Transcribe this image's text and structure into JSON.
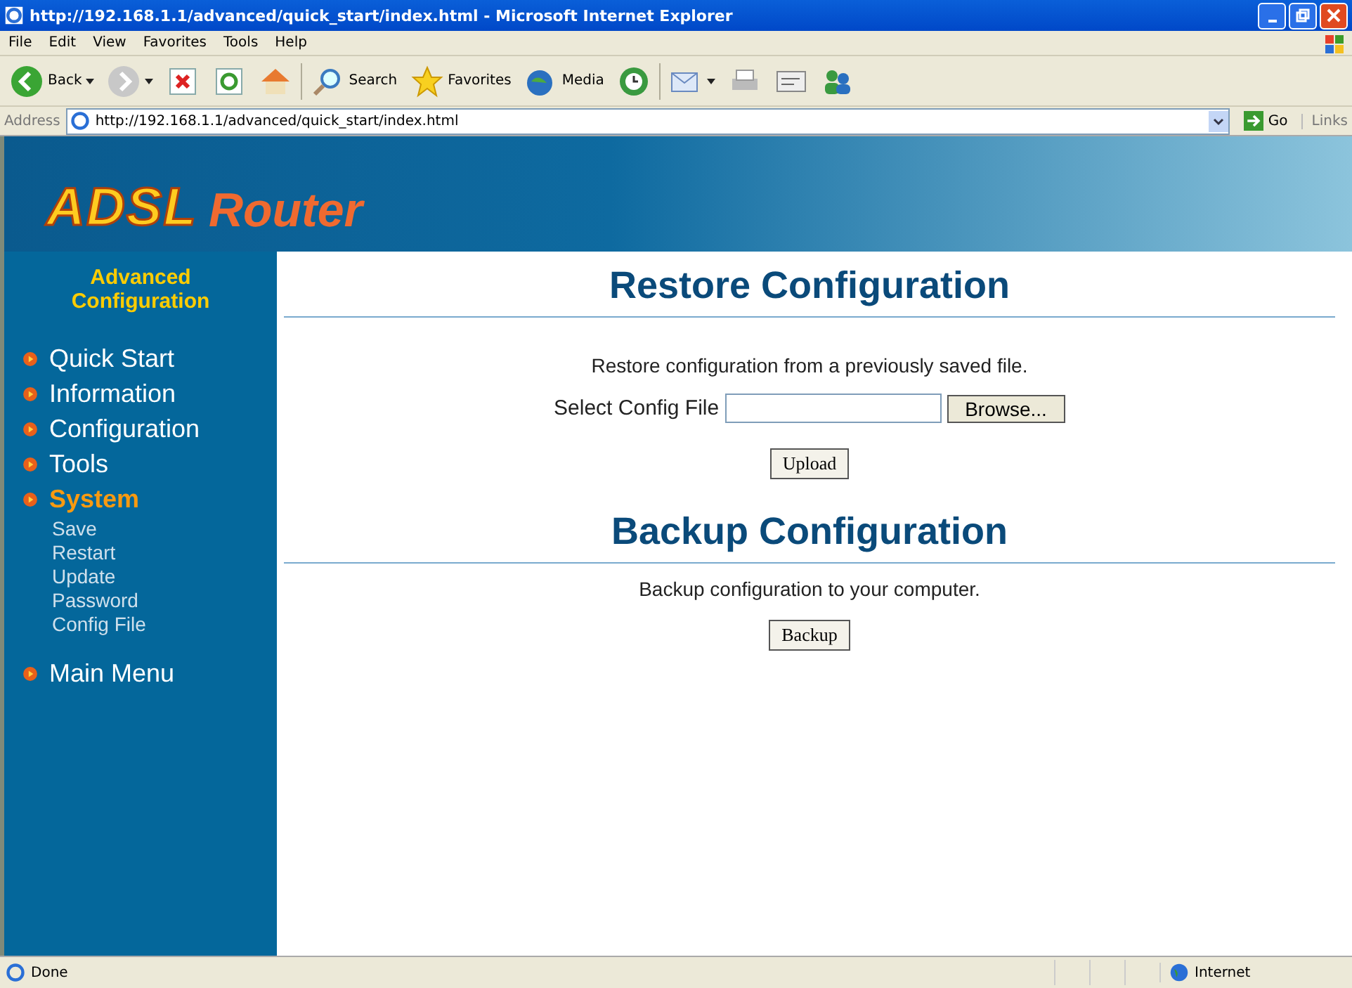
{
  "window": {
    "title": "http://192.168.1.1/advanced/quick_start/index.html - Microsoft Internet Explorer"
  },
  "menu_bar": [
    "File",
    "Edit",
    "View",
    "Favorites",
    "Tools",
    "Help"
  ],
  "toolbar": [
    {
      "kind": "back",
      "label": "Back"
    },
    {
      "kind": "forward"
    },
    {
      "kind": "stop"
    },
    {
      "kind": "refresh"
    },
    {
      "kind": "home"
    },
    {
      "kind": "search",
      "label": "Search"
    },
    {
      "kind": "favorites",
      "label": "Favorites"
    },
    {
      "kind": "media",
      "label": "Media"
    },
    {
      "kind": "history"
    },
    {
      "kind": "mail"
    },
    {
      "kind": "print"
    },
    {
      "kind": "edit"
    },
    {
      "kind": "messenger"
    }
  ],
  "address_bar": {
    "label": "Address",
    "value": "http://192.168.1.1/advanced/quick_start/index.html",
    "go": "Go",
    "links": "Links"
  },
  "banner": {
    "logo_main": "ADSL",
    "logo_sub": "Router"
  },
  "sidebar": {
    "heading": "Advanced Configuration",
    "items": [
      {
        "label": "Quick Start",
        "selected": false
      },
      {
        "label": "Information",
        "selected": false
      },
      {
        "label": "Configuration",
        "selected": false
      },
      {
        "label": "Tools",
        "selected": false
      },
      {
        "label": "System",
        "selected": true,
        "children": [
          "Save",
          "Restart",
          "Update",
          "Password",
          "Config File"
        ]
      },
      {
        "label": "Main Menu",
        "selected": false
      }
    ]
  },
  "restore": {
    "title": "Restore Configuration",
    "description": "Restore configuration from a previously saved file.",
    "field_label": "Select Config File",
    "browse": "Browse...",
    "button": "Upload"
  },
  "backup": {
    "title": "Backup Configuration",
    "description": "Backup configuration to your computer.",
    "button": "Backup"
  },
  "status_bar": {
    "status": "Done",
    "zone": "Internet"
  }
}
